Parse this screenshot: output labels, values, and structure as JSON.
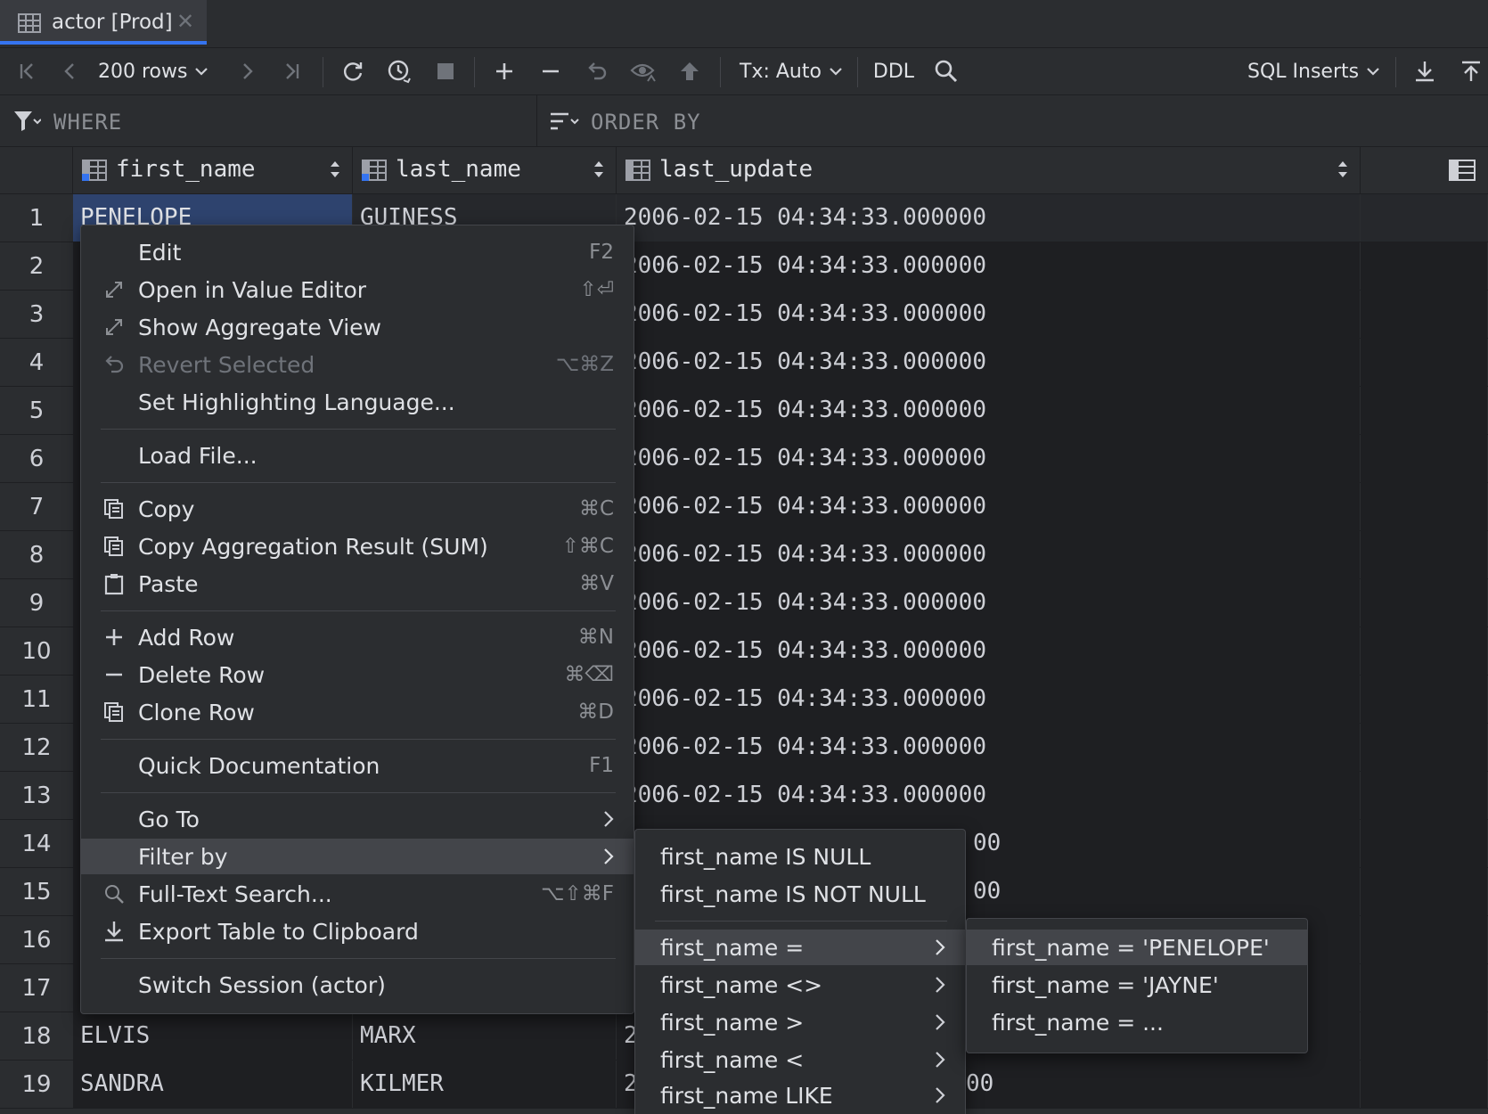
{
  "tab": {
    "label": "actor [Prod]"
  },
  "toolbar": {
    "rows_label": "200 rows",
    "tx_label": "Tx: Auto",
    "ddl_label": "DDL",
    "export_format": "SQL Inserts"
  },
  "filter": {
    "where_label": "WHERE",
    "order_label": "ORDER BY"
  },
  "columns": [
    "first_name",
    "last_name",
    "last_update"
  ],
  "rows": [
    {
      "n": "1",
      "first": "PENELOPE",
      "last": "GUINESS",
      "upd": "2006-02-15 04:34:33.000000"
    },
    {
      "n": "2",
      "first": "",
      "last": "",
      "upd": "2006-02-15 04:34:33.000000"
    },
    {
      "n": "3",
      "first": "",
      "last": "",
      "upd": "2006-02-15 04:34:33.000000"
    },
    {
      "n": "4",
      "first": "",
      "last": "",
      "upd": "2006-02-15 04:34:33.000000"
    },
    {
      "n": "5",
      "first": "",
      "last": "",
      "upd": "2006-02-15 04:34:33.000000"
    },
    {
      "n": "6",
      "first": "",
      "last": "",
      "upd": "2006-02-15 04:34:33.000000"
    },
    {
      "n": "7",
      "first": "",
      "last": "",
      "upd": "2006-02-15 04:34:33.000000"
    },
    {
      "n": "8",
      "first": "",
      "last": "",
      "upd": "2006-02-15 04:34:33.000000"
    },
    {
      "n": "9",
      "first": "",
      "last": "",
      "upd": "2006-02-15 04:34:33.000000"
    },
    {
      "n": "10",
      "first": "",
      "last": "",
      "upd": "2006-02-15 04:34:33.000000"
    },
    {
      "n": "11",
      "first": "",
      "last": "",
      "upd": "2006-02-15 04:34:33.000000"
    },
    {
      "n": "12",
      "first": "",
      "last": "",
      "upd": "2006-02-15 04:34:33.000000"
    },
    {
      "n": "13",
      "first": "",
      "last": "",
      "upd": "2006-02-15 04:34:33.000000"
    },
    {
      "n": "14",
      "first": "",
      "last": "",
      "upd": "00"
    },
    {
      "n": "15",
      "first": "",
      "last": "",
      "upd": "00"
    },
    {
      "n": "16",
      "first": "",
      "last": "",
      "upd": ""
    },
    {
      "n": "17",
      "first": "",
      "last": "",
      "upd": ""
    },
    {
      "n": "18",
      "first": "ELVIS",
      "last": "MARX",
      "upd": "2"
    },
    {
      "n": "19",
      "first": "SANDRA",
      "last": "KILMER",
      "upd": "2"
    }
  ],
  "row19_tail": "00",
  "context_menu": {
    "items": [
      {
        "label": "Edit",
        "shortcut": "F2",
        "icon": "none"
      },
      {
        "label": "Open in Value Editor",
        "shortcut": "⇧⏎",
        "icon": "expand-icon"
      },
      {
        "label": "Show Aggregate View",
        "shortcut": "",
        "icon": "expand-icon"
      },
      {
        "label": "Revert Selected",
        "shortcut": "⌥⌘Z",
        "icon": "revert-icon",
        "disabled": true
      },
      {
        "label": "Set Highlighting Language...",
        "shortcut": "",
        "icon": "none"
      },
      {
        "label": "Load File...",
        "shortcut": "",
        "icon": "none"
      },
      {
        "label": "Copy",
        "shortcut": "⌘C",
        "icon": "copy-icon"
      },
      {
        "label": "Copy Aggregation Result (SUM)",
        "shortcut": "⇧⌘C",
        "icon": "copy-icon"
      },
      {
        "label": "Paste",
        "shortcut": "⌘V",
        "icon": "paste-icon"
      },
      {
        "label": "Add Row",
        "shortcut": "⌘N",
        "icon": "plus-icon"
      },
      {
        "label": "Delete Row",
        "shortcut": "⌘⌫",
        "icon": "minus-icon"
      },
      {
        "label": "Clone Row",
        "shortcut": "⌘D",
        "icon": "copy-icon"
      },
      {
        "label": "Quick Documentation",
        "shortcut": "F1",
        "icon": "none"
      },
      {
        "label": "Go To",
        "shortcut": "",
        "icon": "none",
        "submenu": true
      },
      {
        "label": "Filter by",
        "shortcut": "",
        "icon": "none",
        "submenu": true,
        "selected": true
      },
      {
        "label": "Full-Text Search...",
        "shortcut": "⌥⇧⌘F",
        "icon": "search-icon"
      },
      {
        "label": "Export Table to Clipboard",
        "shortcut": "",
        "icon": "download-icon"
      },
      {
        "label": "Switch Session (actor)",
        "shortcut": "",
        "icon": "none"
      }
    ]
  },
  "filter_submenu": {
    "items": [
      {
        "label": "first_name IS NULL",
        "submenu": false
      },
      {
        "label": "first_name IS NOT NULL",
        "submenu": false
      },
      {
        "label": "first_name =",
        "submenu": true,
        "selected": true
      },
      {
        "label": "first_name <>",
        "submenu": true
      },
      {
        "label": "first_name >",
        "submenu": true
      },
      {
        "label": "first_name <",
        "submenu": true
      },
      {
        "label": "first_name LIKE",
        "submenu": true
      }
    ]
  },
  "equals_submenu": {
    "items": [
      {
        "label": "first_name = 'PENELOPE'",
        "selected": true
      },
      {
        "label": "first_name = 'JAYNE'"
      },
      {
        "label": "first_name = ..."
      }
    ]
  },
  "colors": {
    "accent": "#3574f0",
    "selection": "#2e436e",
    "menu_bg": "#2b2d30",
    "grid_bg": "#1e1f22"
  }
}
